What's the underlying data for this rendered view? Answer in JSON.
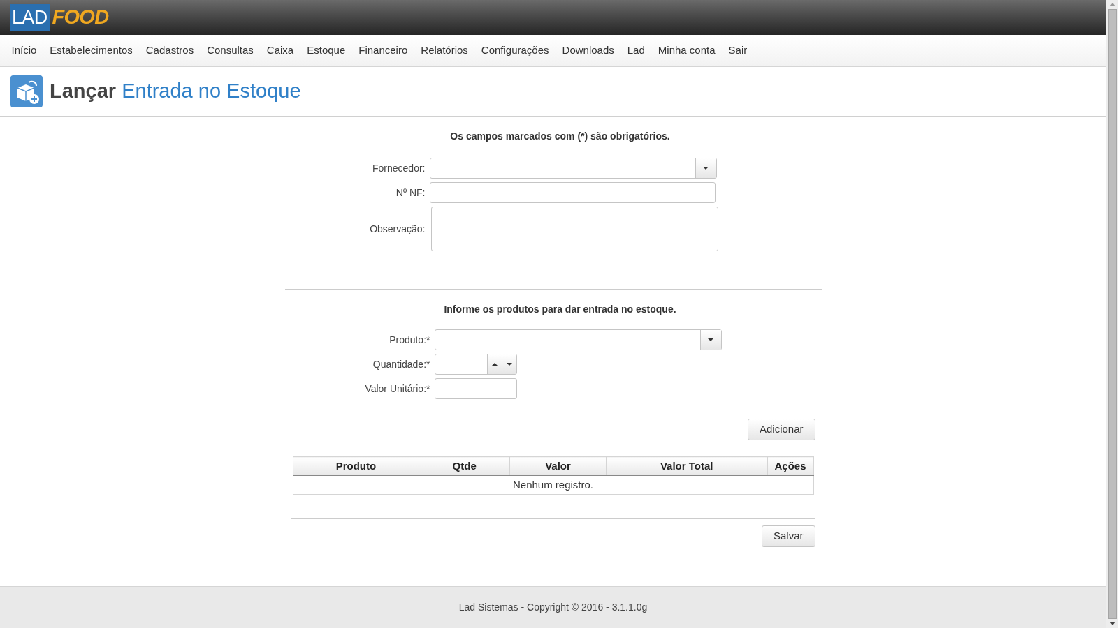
{
  "logo": {
    "left": "LAD",
    "right": "FOOD"
  },
  "nav": [
    "Início",
    "Estabelecimentos",
    "Cadastros",
    "Consultas",
    "Caixa",
    "Estoque",
    "Financeiro",
    "Relatórios",
    "Configurações",
    "Downloads",
    "Lad",
    "Minha conta",
    "Sair"
  ],
  "page_title": {
    "action": "Lançar",
    "subject": "Entrada no Estoque"
  },
  "notice": "Os campos marcados com (*) são obrigatórios.",
  "header_fields": [
    {
      "label": "Fornecedor:",
      "kind": "select"
    },
    {
      "label": "Nº NF:",
      "kind": "text"
    },
    {
      "label": "Observação:",
      "kind": "textarea"
    }
  ],
  "products_notice": "Informe os produtos para dar entrada no estoque.",
  "product_fields": [
    {
      "label": "Produto:*",
      "kind": "select"
    },
    {
      "label": "Quantidade:*",
      "kind": "spinner"
    },
    {
      "label": "Valor Unitário:*",
      "kind": "short"
    }
  ],
  "add_button": "Adicionar",
  "table": {
    "columns": [
      "Produto",
      "Qtde",
      "Valor",
      "Valor Total",
      "Ações"
    ],
    "empty_message": "Nenhum registro."
  },
  "save_button": "Salvar",
  "footer": "Lad Sistemas - Copyright © 2016 - 3.1.1.0g"
}
